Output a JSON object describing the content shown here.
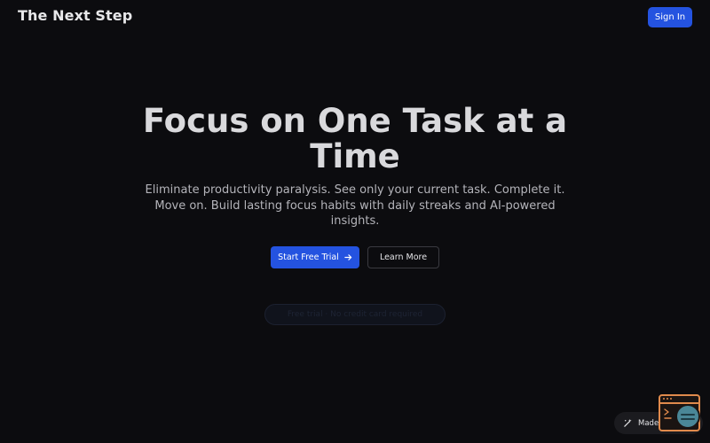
{
  "header": {
    "brand": "The Next Step",
    "sign_in_label": "Sign In"
  },
  "hero": {
    "title": "Focus on One Task at a Time",
    "subtitle": "Eliminate productivity paralysis. See only your current task. Complete it. Move on. Build lasting focus habits with daily streaks and AI-powered insights.",
    "primary_cta_label": "Start Free Trial",
    "primary_cta_icon": "arrow-right-icon",
    "secondary_cta_label": "Learn More",
    "pill_text": "Free trial · No credit card required"
  },
  "badge": {
    "label": "Made with",
    "icon": "wand-icon"
  },
  "dev_widget": {
    "icon": "terminal-icon"
  },
  "colors": {
    "background": "#0c0c0f",
    "accent": "#2453e0",
    "widget_orange": "#e08a4c",
    "avatar_teal": "#4a8797"
  }
}
